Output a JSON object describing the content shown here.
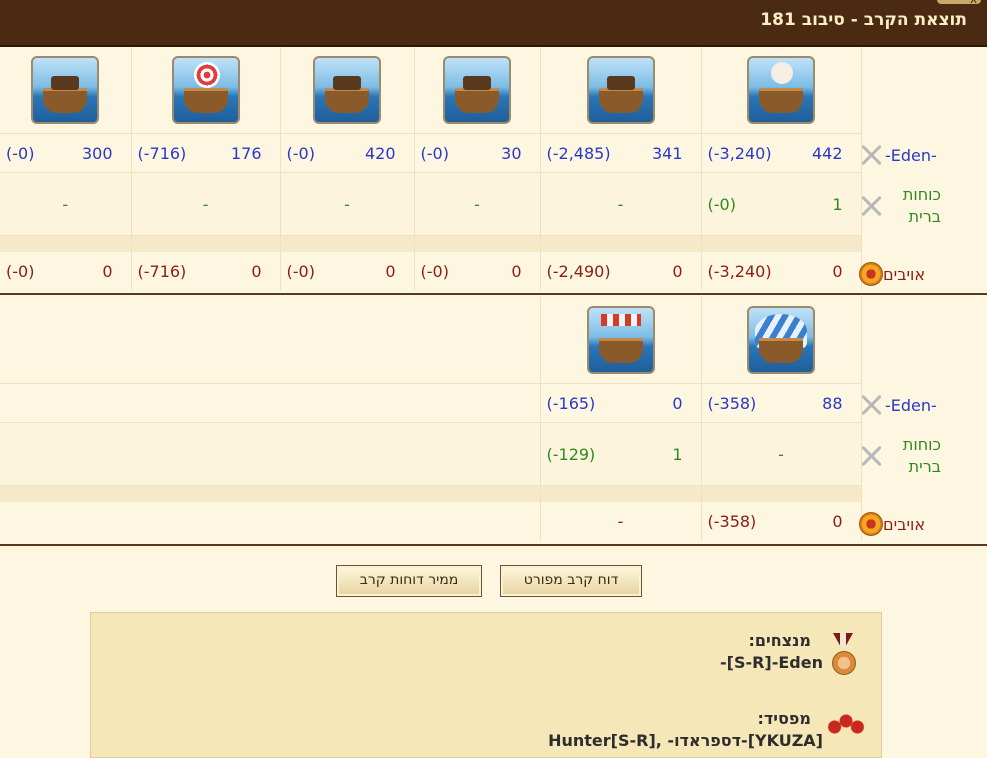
{
  "window": {
    "title": "תוצאת הקרב - סיבוב 181",
    "close_glyph": "X"
  },
  "round1": {
    "units": [
      "ballista-ship",
      "ram-ship",
      "catapult-ship",
      "crane-ship",
      "mortar-ship",
      "target-ship"
    ],
    "rows": {
      "eden": {
        "label": "-Eden-",
        "cells": [
          {
            "n": "442",
            "l": "(-3,240)"
          },
          {
            "n": "341",
            "l": "(-2,485)"
          },
          {
            "n": "30",
            "l": "(-0)"
          },
          {
            "n": "420",
            "l": "(-0)"
          },
          {
            "n": "176",
            "l": "(-716)"
          },
          {
            "n": "300",
            "l": "(-0)"
          }
        ]
      },
      "allies": {
        "label": "כוחות ברית",
        "cells": [
          {
            "n": "1",
            "l": "(-0)"
          },
          {
            "dash": "-"
          },
          {
            "dash": "-"
          },
          {
            "dash": "-"
          },
          {
            "dash": "-"
          },
          {
            "dash": "-"
          }
        ]
      },
      "enemies": {
        "label": "אויבים",
        "cells": [
          {
            "n": "0",
            "l": "(-3,240)"
          },
          {
            "n": "0",
            "l": "(-2,490)"
          },
          {
            "n": "0",
            "l": "(-0)"
          },
          {
            "n": "0",
            "l": "(-0)"
          },
          {
            "n": "0",
            "l": "(-716)"
          },
          {
            "n": "0",
            "l": "(-0)"
          }
        ]
      }
    }
  },
  "round2": {
    "units": [
      "balloon-carrier",
      "flamethrower-ship"
    ],
    "rows": {
      "eden": {
        "label": "-Eden-",
        "cells": [
          {
            "n": "88",
            "l": "(-358)"
          },
          {
            "n": "0",
            "l": "(-165)"
          }
        ]
      },
      "allies": {
        "label": "כוחות ברית",
        "cells": [
          {
            "dash": "-"
          },
          {
            "n": "1",
            "l": "(-129)"
          }
        ]
      },
      "enemies": {
        "label": "אויבים",
        "cells": [
          {
            "n": "0",
            "l": "(-358)"
          },
          {
            "dash": "-"
          }
        ]
      }
    }
  },
  "buttons": {
    "detailed": "דוח קרב מפורט",
    "convert": "ממיר דוחות קרב"
  },
  "result": {
    "winners_label": "מנצחים:",
    "winners_value": "-[S-R]-Eden",
    "loser_label": "מפסיד:",
    "loser_value": "Hunter[S-R], -דספראדו-[YKUZA]"
  },
  "colors": {
    "title_bg": "#4a2a12",
    "own_units": "#2a38c8",
    "allied_units": "#2f8a1b",
    "enemy_units": "#8a1e14"
  }
}
